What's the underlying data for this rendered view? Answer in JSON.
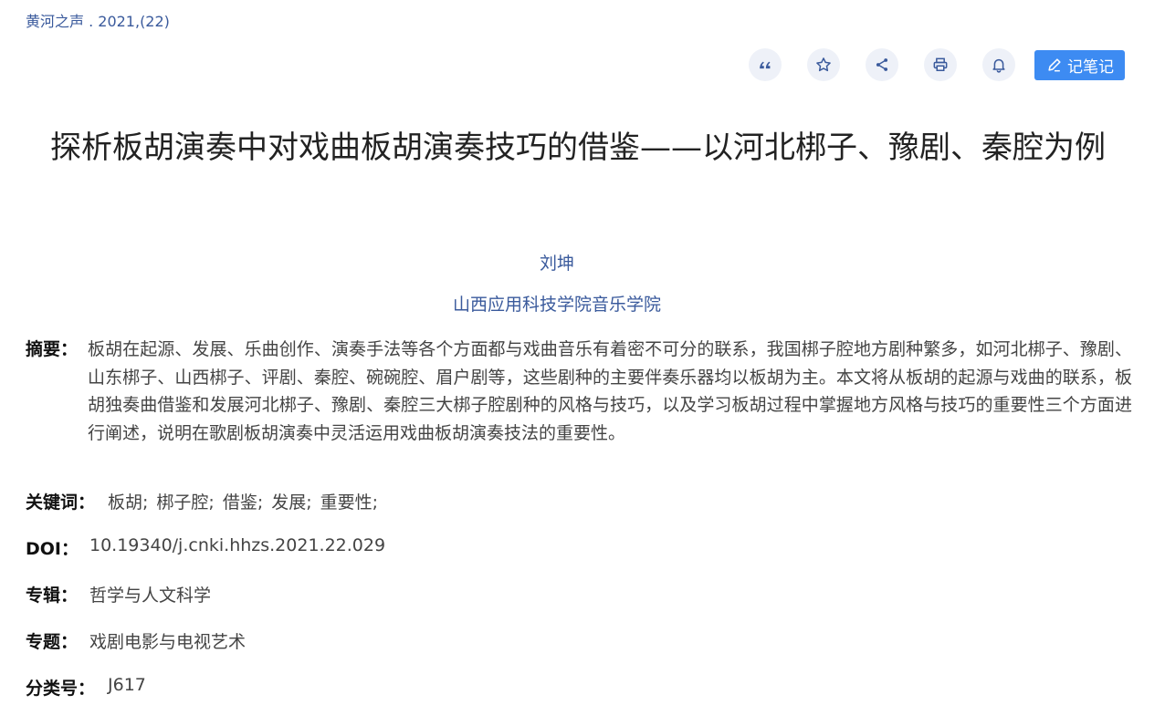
{
  "source": {
    "text": "黄河之声 . 2021,(22)"
  },
  "toolbar": {
    "note_label": "记笔记"
  },
  "article": {
    "title": "探析板胡演奏中对戏曲板胡演奏技巧的借鉴——以河北梆子、豫剧、秦腔为例",
    "author": "刘坤",
    "institution": "山西应用科技学院音乐学院",
    "abstract_label": "摘要：",
    "abstract": "板胡在起源、发展、乐曲创作、演奏手法等各个方面都与戏曲音乐有着密不可分的联系，我国梆子腔地方剧种繁多，如河北梆子、豫剧、山东梆子、山西梆子、评剧、秦腔、碗碗腔、眉户剧等，这些剧种的主要伴奏乐器均以板胡为主。本文将从板胡的起源与戏曲的联系，板胡独奏曲借鉴和发展河北梆子、豫剧、秦腔三大梆子腔剧种的风格与技巧，以及学习板胡过程中掌握地方风格与技巧的重要性三个方面进行阐述，说明在歌剧板胡演奏中灵活运用戏曲板胡演奏技法的重要性。",
    "keywords_label": "关键词：",
    "keywords": [
      "板胡;",
      "梆子腔;",
      "借鉴;",
      "发展;",
      "重要性;"
    ],
    "doi_label": "DOI：",
    "doi": "10.19340/j.cnki.hhzs.2021.22.029",
    "series_label": "专辑：",
    "series": "哲学与人文科学",
    "topic_label": "专题：",
    "topic": "戏剧电影与电视艺术",
    "clc_label": "分类号：",
    "clc": "J617"
  },
  "colors": {
    "link": "#3a5a9c",
    "accent": "#3d8bf2",
    "icon_bg": "#eef1f8"
  },
  "icons": [
    "quote-icon",
    "star-icon",
    "share-icon",
    "print-icon",
    "bell-icon",
    "pencil-icon"
  ]
}
